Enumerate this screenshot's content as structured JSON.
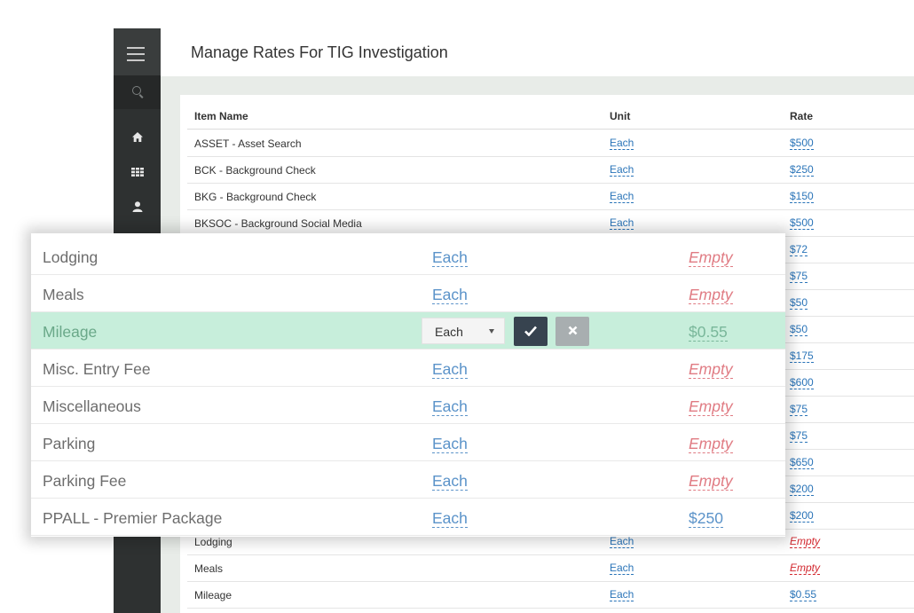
{
  "page": {
    "title": "Manage Rates For TIG Investigation"
  },
  "table": {
    "headers": {
      "item": "Item Name",
      "unit": "Unit",
      "rate": "Rate"
    },
    "rows": [
      {
        "item": "ASSET - Asset Search",
        "unit": "Each",
        "rate": "$500"
      },
      {
        "item": "BCK - Background Check",
        "unit": "Each",
        "rate": "$250"
      },
      {
        "item": "BKG - Background Check",
        "unit": "Each",
        "rate": "$150"
      },
      {
        "item": "BKSOC - Background Social Media",
        "unit": "Each",
        "rate": "$500"
      },
      {
        "rate": "$72"
      },
      {
        "rate": "$75"
      },
      {
        "rate": "$50"
      },
      {
        "rate": "$50"
      },
      {
        "rate": "$175"
      },
      {
        "rate": "$600"
      },
      {
        "rate": "$75"
      },
      {
        "rate": "$75"
      },
      {
        "rate": "$650"
      },
      {
        "rate": "$200"
      },
      {
        "rate": "$200"
      },
      {
        "item": "Lodging",
        "unit": "Each",
        "rate": "Empty"
      },
      {
        "item": "Meals",
        "unit": "Each",
        "rate": "Empty"
      },
      {
        "item": "Mileage",
        "unit": "Each",
        "rate": "$0.55"
      }
    ]
  },
  "overlay": {
    "rows": [
      {
        "item": "Lodging",
        "unit": "Each",
        "rate": "Empty"
      },
      {
        "item": "Meals",
        "unit": "Each",
        "rate": "Empty"
      },
      {
        "item": "Mileage",
        "unit_select": "Each",
        "rate": "$0.55"
      },
      {
        "item": "Misc. Entry Fee",
        "unit": "Each",
        "rate": "Empty"
      },
      {
        "item": "Miscellaneous",
        "unit": "Each",
        "rate": "Empty"
      },
      {
        "item": "Parking",
        "unit": "Each",
        "rate": "Empty"
      },
      {
        "item": "Parking Fee",
        "unit": "Each",
        "rate": "Empty"
      },
      {
        "item": "PPALL - Premier Package",
        "unit": "Each",
        "rate": "$250"
      }
    ]
  },
  "icons": {
    "sidebar": [
      "menu-icon",
      "search-icon",
      "home-icon",
      "grid-icon",
      "user-icon"
    ],
    "editor": [
      "check-icon",
      "close-icon"
    ]
  },
  "colors": {
    "sidebar": "#2e3131",
    "link": "#2a74b8",
    "empty": "#d2282f",
    "editing_row": "#c7eedb",
    "confirm_button": "#37434f",
    "cancel_button": "#a8aeb0"
  }
}
